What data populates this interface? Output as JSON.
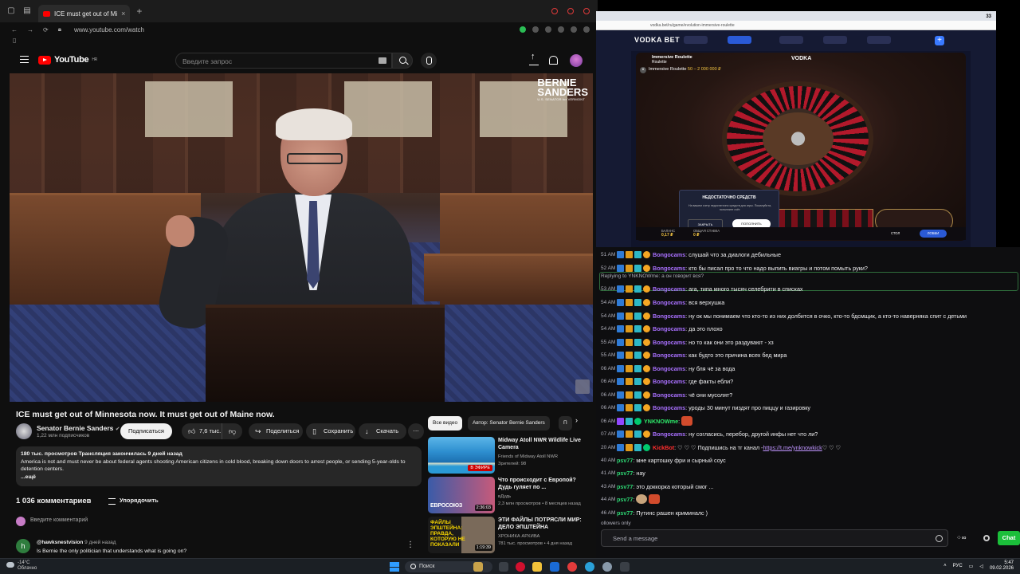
{
  "browser": {
    "tab_title": "ICE must get out of Mi",
    "url": "www.youtube.com/watch"
  },
  "youtube": {
    "logo_text": "YouTube",
    "logo_region": "HR",
    "search_placeholder": "Введите запрос",
    "video": {
      "overlay_logo_line1": "BERNIE",
      "overlay_logo_line2": "SANDERS",
      "overlay_logo_sub": "U.S. SENATOR for VERMONT",
      "title": "ICE must get out of Minnesota now. It must get out of Maine now."
    },
    "channel": {
      "name": "Senator Bernie Sanders",
      "subscribers": "1,22 млн подписчиков",
      "subscribe_label": "Подписаться"
    },
    "actions": {
      "likes": "7,6 тыс.",
      "share": "Поделиться",
      "save": "Сохранить",
      "download": "Скачать"
    },
    "description": {
      "meta": "180 тыс. просмотров  Трансляция закончилась 9 дней назад",
      "text": "America is not and must never be about federal agents shooting American citizens in cold blood, breaking down doors to arrest people, or sending 5-year-olds to detention centers.",
      "more": "...ещё"
    },
    "comments": {
      "count": "1 036 комментариев",
      "sort_label": "Упорядочить",
      "add_placeholder": "Введите комментарий",
      "first": {
        "avatar_letter": "h",
        "author": "@hawksnestvision",
        "time": "9 дней назад",
        "text": "Is Bernie the only politician that understands what is going on?"
      }
    },
    "chips": [
      "Все видео",
      "Автор: Senator Bernie Sanders",
      "П"
    ],
    "recommendations": [
      {
        "title": "Midway Atoll NWR Wildlife Live Camera",
        "channel": "Friends of Midway Atoll NWR",
        "stats": "Зрителей: 98",
        "badge": "В ЭФИРЕ",
        "thumb_text": ""
      },
      {
        "title": "Что происходит с Европой? Дудь гуляет по ...",
        "channel": "вДудь",
        "stats": "2,3 млн просмотров • 8 месяцев назад",
        "badge": "2:36:03",
        "thumb_text": "ЕВРОСОЮЗ"
      },
      {
        "title": "ЭТИ ФАЙЛЫ ПОТРЯСЛИ МИР: ДЕЛО ЭПШТЕЙНА",
        "channel": "ХРОНИКА АРХИВА",
        "stats": "781 тыс. просмотров • 4 дня назад",
        "badge": "1:19:39",
        "thumb_text": "ФАЙЛЫ ЭПШТЕЙНА: ПРАВДА, КОТОРУЮ НЕ ПОКАЗАЛИ"
      }
    ]
  },
  "casino": {
    "tab_count": "33",
    "url": "vodka.bet/ru/game/evolution-immersive-roulette",
    "logo": "VODKA BET",
    "game_header": "Immersive Roulette",
    "game_header_sub": "Roulette",
    "game_logo": "VODKA",
    "game_name": "Immersive Roulette",
    "limits": "50 – 2 000 000 ₽",
    "alert": {
      "title": "НЕДОСТАТОЧНО СРЕДСТВ",
      "text": "На вашем счету недостаточно средств для игры. Пожалуйста, пополните счёт.",
      "close": "ЗАКРЫТЬ",
      "deposit": "ПОПОЛНИТЬ"
    },
    "bet_labels": [
      "1-18",
      "EVEN",
      "ODD",
      "19-36"
    ],
    "balance_label": "БАЛАНС",
    "balance": "0,17 ₽",
    "total_bet_label": "ОБЩАЯ СТАВКА",
    "total_bet": "0 ₽",
    "table_label": "СТОЛ",
    "lobby_label": "ЛОББИ"
  },
  "chat": {
    "reply_hint": "Replying to YNKNOWme: а он говорит вся?",
    "messages": [
      {
        "time": "51 AM",
        "user": "Bongocams",
        "cls": "u-bong",
        "badges": "a,g,t,c",
        "text": ": слушай что за диалоги дебильные"
      },
      {
        "time": "52 AM",
        "user": "Bongocams",
        "cls": "u-bong",
        "badges": "a,g,t,c",
        "text": ": кто бы писал про то что надо выпить виагры и потом помыть руки?"
      },
      {
        "time": "53 AM",
        "user": "Bongocams",
        "cls": "u-bong",
        "badges": "a,g,t,c",
        "text": ": ага, типа много тысяч селебрити в списках"
      },
      {
        "time": "54 AM",
        "user": "Bongocams",
        "cls": "u-bong",
        "badges": "a,g,t,c",
        "text": ": вся верхушка"
      },
      {
        "time": "54 AM",
        "user": "Bongocams",
        "cls": "u-bong",
        "badges": "a,g,t,c",
        "text": ": ну ок мы понимаем что кто-то из них долбится в очко, кто-то бдсмщик, а кто-то наверняка спит с детьми"
      },
      {
        "time": "54 AM",
        "user": "Bongocams",
        "cls": "u-bong",
        "badges": "a,g,t,c",
        "text": ": да это плохо"
      },
      {
        "time": "55 AM",
        "user": "Bongocams",
        "cls": "u-bong",
        "badges": "a,g,t,c",
        "text": ": но то как они это раздувают - хз"
      },
      {
        "time": "55 AM",
        "user": "Bongocams",
        "cls": "u-bong",
        "badges": "a,g,t,c",
        "text": ": как будто это причина всех бед мира"
      },
      {
        "time": "06 AM",
        "user": "Bongocams",
        "cls": "u-bong",
        "badges": "a,g,t,c",
        "text": ": ну бля чё за вода"
      },
      {
        "time": "06 AM",
        "user": "Bongocams",
        "cls": "u-bong",
        "badges": "a,g,t,c",
        "text": ": где факты ебли?"
      },
      {
        "time": "06 AM",
        "user": "Bongocams",
        "cls": "u-bong",
        "badges": "a,g,t,c",
        "text": ": чё они мусолят?"
      },
      {
        "time": "06 AM",
        "user": "Bongocams",
        "cls": "u-bong",
        "badges": "a,g,t,c",
        "text": ": уроды 30 минут пиздят про пиццу и газировку"
      },
      {
        "time": "06 AM",
        "user": "YNKNOWme",
        "cls": "u-ynk",
        "badges": "p,t,gr",
        "text": ":",
        "emote": true
      },
      {
        "time": "07 AM",
        "user": "Bongocams",
        "cls": "u-bong",
        "badges": "a,g,t,c",
        "text": ": ну согласись, перебор, другой инфы нет что ли?"
      },
      {
        "time": "20 AM",
        "user": "KickBot",
        "cls": "u-kick",
        "badges": "a,g,t,gr",
        "text": ": ♡ ♡ ♡ Подпишись на тг канал - ",
        "link": "https://t.me/ynknowkick",
        "tail": " ♡ ♡ ♡"
      },
      {
        "time": "40 AM",
        "user": "psv77",
        "cls": "u-psv",
        "badges": "",
        "text": ": мне картошку фри и сырный соус"
      },
      {
        "time": "41 AM",
        "user": "psv77",
        "cls": "u-psv",
        "badges": "",
        "text": ": нау"
      },
      {
        "time": "43 AM",
        "user": "psv77",
        "cls": "u-psv",
        "badges": "",
        "text": ": это доккорка который смог ..."
      },
      {
        "time": "44 AM",
        "user": "psv77",
        "cls": "u-psv",
        "badges": "",
        "text": ":",
        "emote2": true
      },
      {
        "time": "46 AM",
        "user": "psv77",
        "cls": "u-psv",
        "badges": "",
        "text": ": Путинс рашен криминалс )"
      }
    ],
    "followers_only": "ollowers only",
    "input_placeholder": "Send a message",
    "chat_button": "Chat"
  },
  "taskbar": {
    "temp": "-14°C",
    "condition": "Облачно",
    "search": "Поиск",
    "lang": "РУС",
    "time": "5:47",
    "date": "09.02.2026"
  }
}
